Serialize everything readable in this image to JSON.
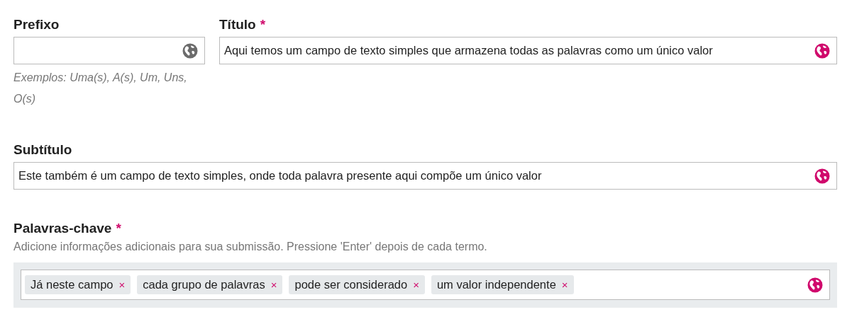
{
  "prefix": {
    "label": "Prefixo",
    "globe_active": false,
    "help": "Exemplos: Uma(s), A(s), Um, Uns, O(s)"
  },
  "title": {
    "label": "Título",
    "required_mark": "*",
    "globe_active": true,
    "value": "Aqui temos um campo de texto simples que armazena todas as palavras como um único valor"
  },
  "subtitle": {
    "label": "Subtítulo",
    "globe_active": true,
    "value": "Este também é um campo de texto simples, onde toda palavra presente aqui compõe um único valor"
  },
  "keywords": {
    "label": "Palavras-chave",
    "required_mark": "*",
    "description": "Adicione informações adicionais para sua submissão. Pressione 'Enter' depois de cada termo.",
    "globe_active": true,
    "tags": [
      {
        "label": "Já neste campo",
        "remove": "×"
      },
      {
        "label": "cada grupo de palavras",
        "remove": "×"
      },
      {
        "label": "pode ser considerado",
        "remove": "×"
      },
      {
        "label": "um valor independente",
        "remove": "×"
      }
    ]
  }
}
